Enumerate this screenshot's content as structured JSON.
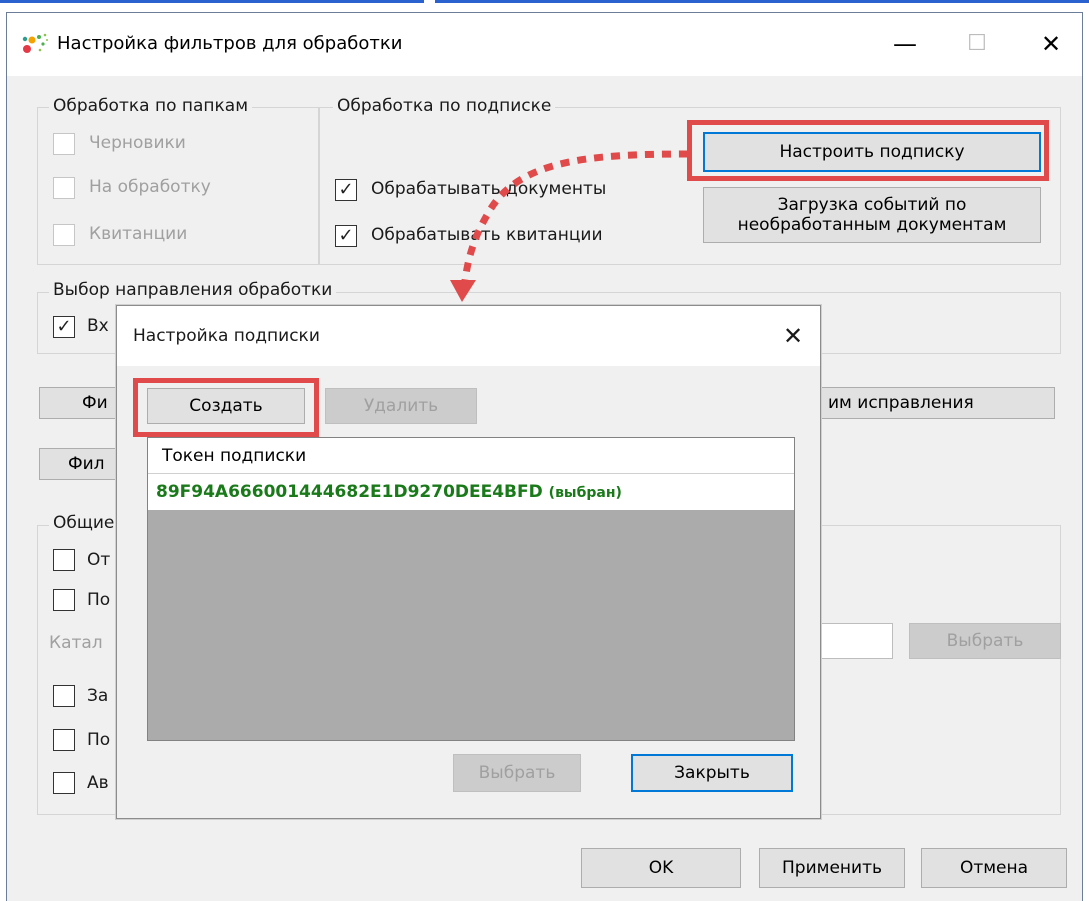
{
  "window": {
    "title": "Настройка фильтров для обработки",
    "minimize_glyph": "—",
    "maximize_glyph": "☐",
    "close_glyph": "✕"
  },
  "folders_group": {
    "label": "Обработка по папкам",
    "items": [
      {
        "label": "Черновики",
        "checked": false,
        "enabled": false
      },
      {
        "label": "На обработку",
        "checked": false,
        "enabled": false
      },
      {
        "label": "Квитанции",
        "checked": false,
        "enabled": false
      }
    ]
  },
  "subscription_group": {
    "label": "Обработка по подписке",
    "items": [
      {
        "label": "Обрабатывать документы",
        "checked": true
      },
      {
        "label": "Обрабатывать квитанции",
        "checked": true
      }
    ],
    "configure_button": "Настроить подписку",
    "load_events_button_line1": "Загрузка событий по",
    "load_events_button_line2": "необработанным документам"
  },
  "direction_group": {
    "label": "Выбор направления обработки",
    "items": [
      {
        "label": "Вх",
        "checked": true
      }
    ]
  },
  "partial_buttons": {
    "filter1": "Фи",
    "filter2": "Фил",
    "correction_mode": "им исправления"
  },
  "general_group": {
    "label": "Общие",
    "items": [
      {
        "label": "От",
        "checked": false
      },
      {
        "label": "По",
        "checked": false
      },
      {
        "label": "За",
        "checked": false
      },
      {
        "label": "По",
        "checked": false
      },
      {
        "label": "Ав",
        "checked": false
      }
    ],
    "catalog_label": "Катал",
    "select_button": "Выбрать"
  },
  "footer": {
    "ok": "OK",
    "apply": "Применить",
    "cancel": "Отмена"
  },
  "dialog": {
    "title": "Настройка подписки",
    "close_glyph": "✕",
    "create_button": "Создать",
    "delete_button": "Удалить",
    "list_header": "Токен подписки",
    "token": "89F94A666001444682E1D9270DEE4BFD",
    "selected_suffix": "(выбран)",
    "select_button": "Выбрать",
    "close_button": "Закрыть"
  },
  "colors": {
    "highlight": "#e04a4a",
    "token_green": "#1a7a1a",
    "focus_blue": "#0078d7"
  }
}
